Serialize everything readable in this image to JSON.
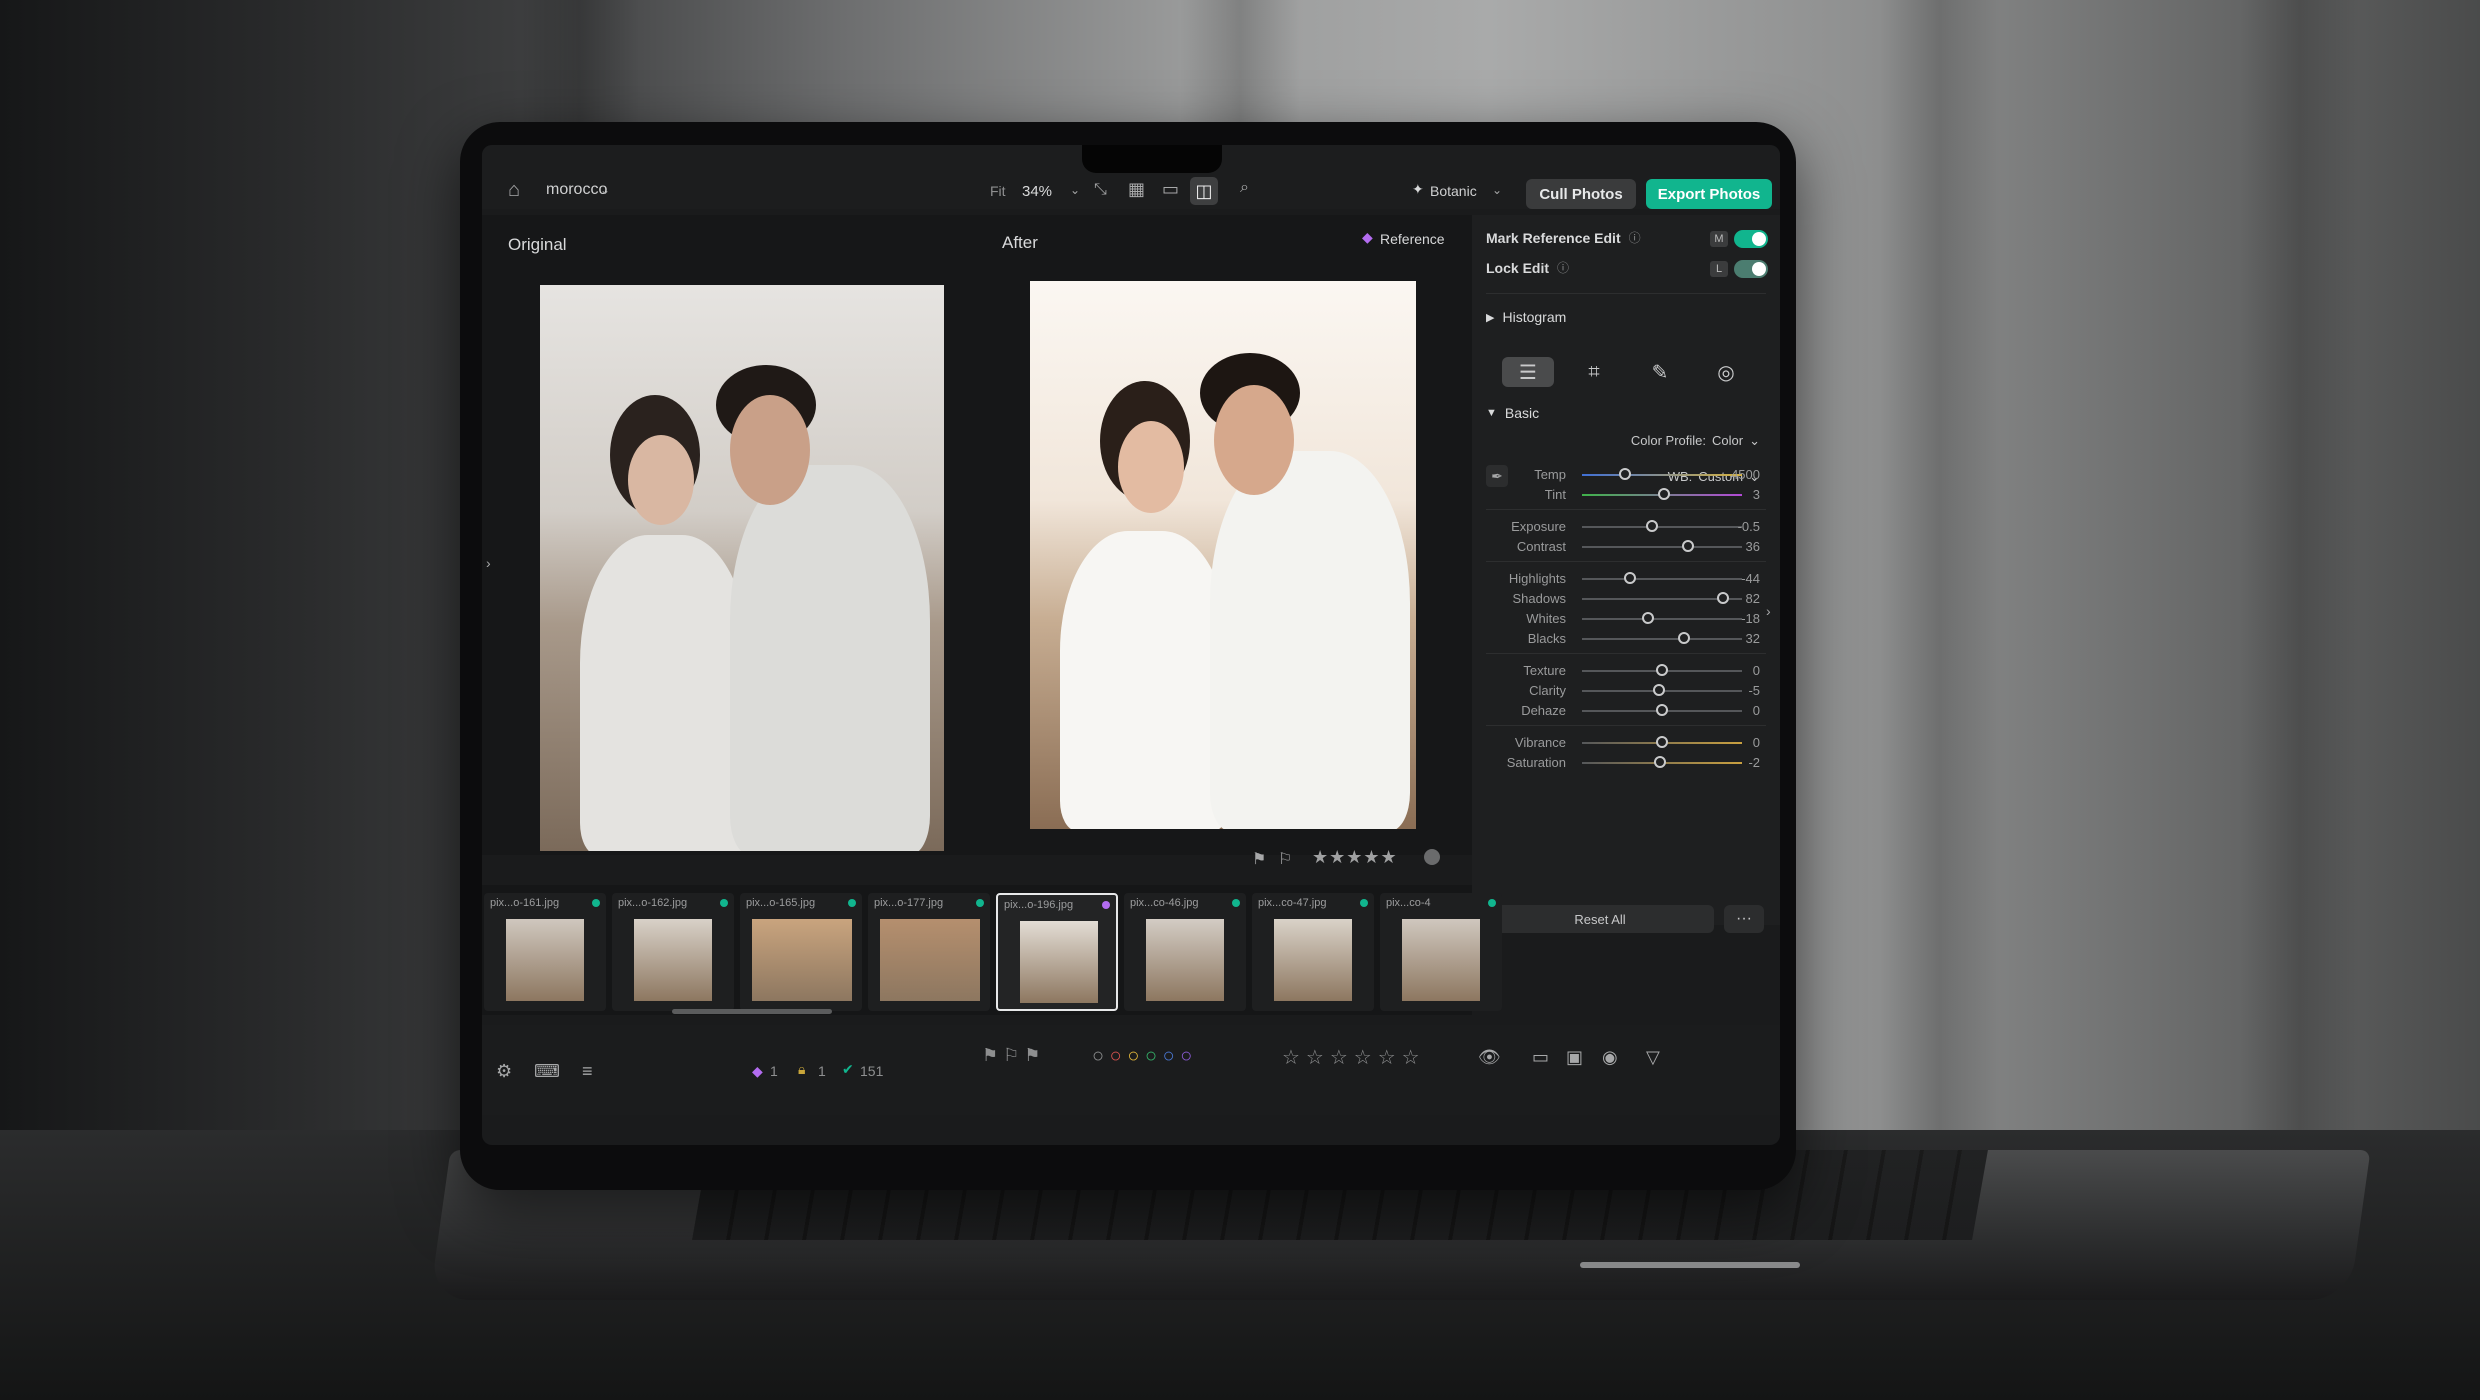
{
  "app": {
    "project": "morocco",
    "zoom_mode": "Fit",
    "zoom_value": "34%",
    "preset": "Botanic"
  },
  "toolbar": {
    "cull_label": "Cull Photos",
    "export_label": "Export Photos"
  },
  "viewer": {
    "original_label": "Original",
    "after_label": "After",
    "reference_label": "Reference"
  },
  "panel": {
    "mark_reference_label": "Mark Reference Edit",
    "mark_reference_key": "M",
    "lock_edit_label": "Lock Edit",
    "lock_edit_key": "L",
    "histogram_label": "Histogram",
    "basic_label": "Basic",
    "color_profile_label": "Color Profile:",
    "color_profile_value": "Color",
    "wb_label": "WB:",
    "wb_value": "Custom",
    "reset_label": "Reset All",
    "more_label": "···",
    "sliders": [
      {
        "label": "Temp",
        "value": "4500",
        "pos": 0.27
      },
      {
        "label": "Tint",
        "value": "3",
        "pos": 0.51
      },
      {
        "label": "Exposure",
        "value": "-0.5",
        "pos": 0.44
      },
      {
        "label": "Contrast",
        "value": "36",
        "pos": 0.66
      },
      {
        "label": "Highlights",
        "value": "-44",
        "pos": 0.3
      },
      {
        "label": "Shadows",
        "value": "82",
        "pos": 0.88
      },
      {
        "label": "Whites",
        "value": "-18",
        "pos": 0.41
      },
      {
        "label": "Blacks",
        "value": "32",
        "pos": 0.64
      },
      {
        "label": "Texture",
        "value": "0",
        "pos": 0.5
      },
      {
        "label": "Clarity",
        "value": "-5",
        "pos": 0.48
      },
      {
        "label": "Dehaze",
        "value": "0",
        "pos": 0.5
      },
      {
        "label": "Vibrance",
        "value": "0",
        "pos": 0.5
      },
      {
        "label": "Saturation",
        "value": "-2",
        "pos": 0.49
      }
    ]
  },
  "filmstrip": [
    {
      "name": "pix...o-161.jpg"
    },
    {
      "name": "pix...o-162.jpg"
    },
    {
      "name": "pix...o-165.jpg"
    },
    {
      "name": "pix...o-177.jpg"
    },
    {
      "name": "pix...o-196.jpg"
    },
    {
      "name": "pix...co-46.jpg"
    },
    {
      "name": "pix...co-47.jpg"
    },
    {
      "name": "pix...co-4"
    }
  ],
  "bottombar": {
    "purple_count": "1",
    "lock_count": "1",
    "check_count": "151"
  }
}
